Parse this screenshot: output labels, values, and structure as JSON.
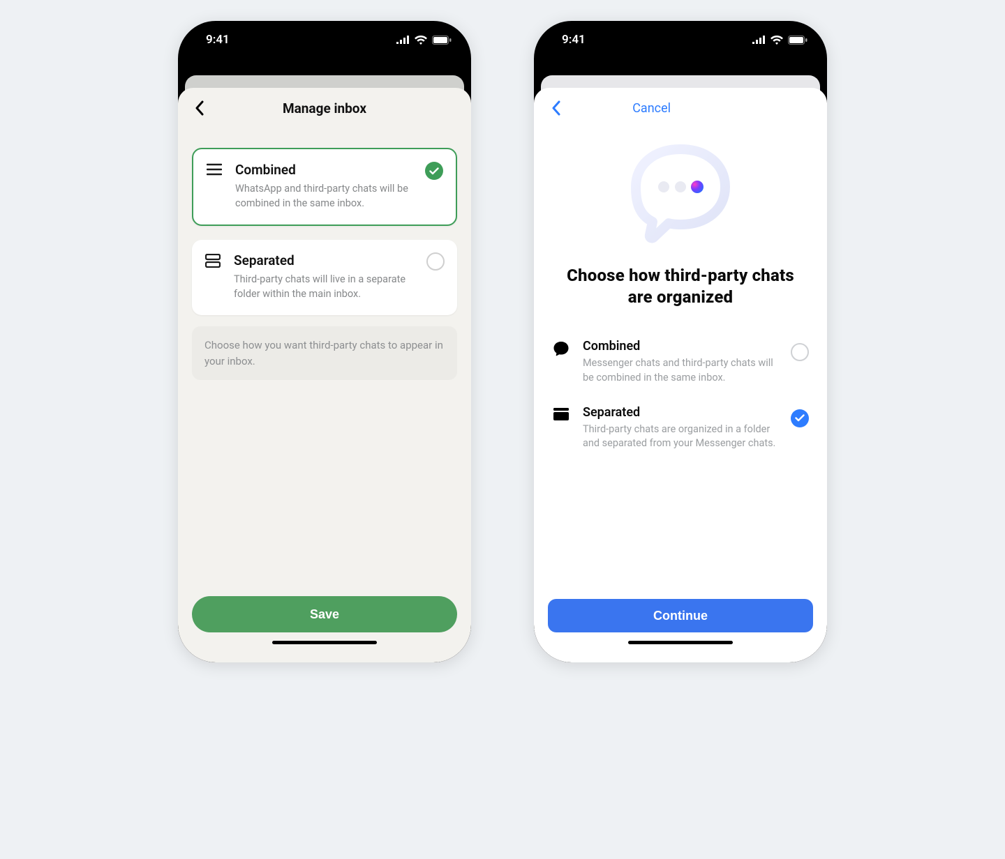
{
  "status": {
    "time": "9:41"
  },
  "left": {
    "title": "Manage inbox",
    "options": [
      {
        "title": "Combined",
        "desc": "WhatsApp and third-party chats will be combined in the same inbox."
      },
      {
        "title": "Separated",
        "desc": "Third-party chats will live in a separate folder within the main inbox."
      }
    ],
    "caption": "Choose how you want third-party chats to appear in your inbox.",
    "save": "Save"
  },
  "right": {
    "cancel": "Cancel",
    "heading": "Choose how third-party chats are organized",
    "options": [
      {
        "title": "Combined",
        "desc": "Messenger chats and third-party chats will be combined in the same inbox."
      },
      {
        "title": "Separated",
        "desc": "Third-party chats are organized in a folder and separated from your Messenger chats."
      }
    ],
    "continue": "Continue"
  }
}
